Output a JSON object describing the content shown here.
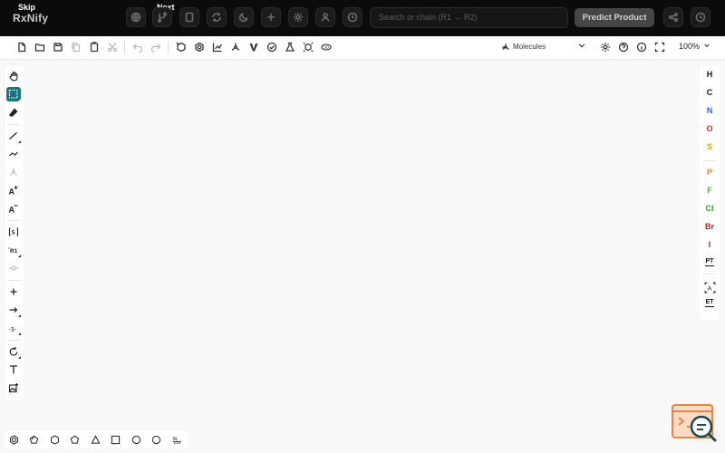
{
  "topbar": {
    "brand": "RxNify",
    "skip_label": "Skip",
    "next_label": "Next",
    "icons": [
      "globe-icon",
      "branch-icon",
      "book-icon",
      "refresh-icon",
      "moon-icon",
      "plus-icon",
      "gear-icon",
      "user-icon",
      "history-icon"
    ],
    "search_placeholder": "Search or chain (R1 → R2)",
    "predict_label": "Predict Product",
    "share_icon": "share-icon",
    "clock_icon": "clock-icon"
  },
  "ketcher_toolbar": {
    "left_icons": [
      "new-file-icon",
      "open-file-icon",
      "save-icon",
      "copy-icon",
      "paste-icon",
      "cut-icon",
      "undo-icon",
      "redo-icon",
      "clean-up-icon",
      "aromatize-icon",
      "calculate-icon",
      "layout-icon",
      "check-icon",
      "stereo-icon",
      "explicit-hydrogens-icon",
      "3d-view-icon"
    ],
    "mode_label": "Molecules",
    "right_icons": [
      "settings-icon",
      "help-icon",
      "info-icon",
      "fullscreen-icon"
    ],
    "zoom_value": "100%"
  },
  "left_tools": [
    "hand-icon",
    "select-icon",
    "eraser-icon",
    "bond-icon",
    "chain-icon",
    "stereo-icon",
    "charge-plus-icon",
    "charge-minus-icon",
    "sgroup-icon",
    "rgroup-icon",
    "attachment-icon",
    "reaction-plus-icon",
    "arrow-icon",
    "mapping-icon",
    "rotate-icon",
    "text-icon",
    "image-icon"
  ],
  "elements": {
    "H": {
      "label": "H",
      "color": "#111111"
    },
    "C": {
      "label": "C",
      "color": "#111111"
    },
    "N": {
      "label": "N",
      "color": "#2d5bd8"
    },
    "O": {
      "label": "O",
      "color": "#e0242b"
    },
    "S": {
      "label": "S",
      "color": "#c8a214"
    },
    "P": {
      "label": "P",
      "color": "#ef7d11"
    },
    "F": {
      "label": "F",
      "color": "#5ab21f"
    },
    "Cl": {
      "label": "Cl",
      "color": "#20a52b"
    },
    "Br": {
      "label": "Br",
      "color": "#a1262a"
    },
    "I": {
      "label": "I",
      "color": "#8a1c8f"
    },
    "pt": "PT",
    "et": "ET"
  },
  "shapes": [
    "benzene-icon",
    "cyclopentadiene-icon",
    "cyclohexane-icon",
    "cyclopentane-icon",
    "cyclopropane-icon",
    "cyclobutane-icon",
    "cycloheptane-icon",
    "cyclooctane-icon",
    "templates-icon"
  ],
  "accent_color": "#167782"
}
